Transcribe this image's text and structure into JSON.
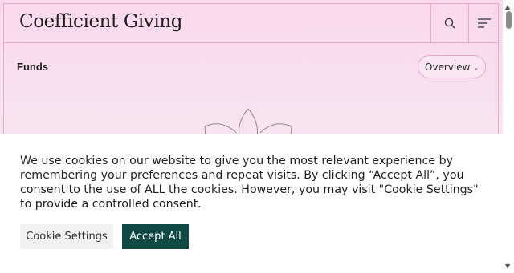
{
  "header": {
    "brand": "Coefficient Giving",
    "search_icon": "search-icon",
    "menu_icon": "menu-icon"
  },
  "subbar": {
    "title": "Funds",
    "dropdown_label": "Overview"
  },
  "cookie_banner": {
    "message": "We use cookies on our website to give you the most relevant experience by remembering your preferences and repeat visits. By clicking “Accept All”, you consent to the use of ALL the cookies. However, you may visit \"Cookie Settings\" to provide a controlled consent.",
    "settings_label": "Cookie Settings",
    "accept_label": "Accept All"
  },
  "colors": {
    "accent_pink": "#e9a9cb",
    "accept_green": "#0e4a43"
  }
}
